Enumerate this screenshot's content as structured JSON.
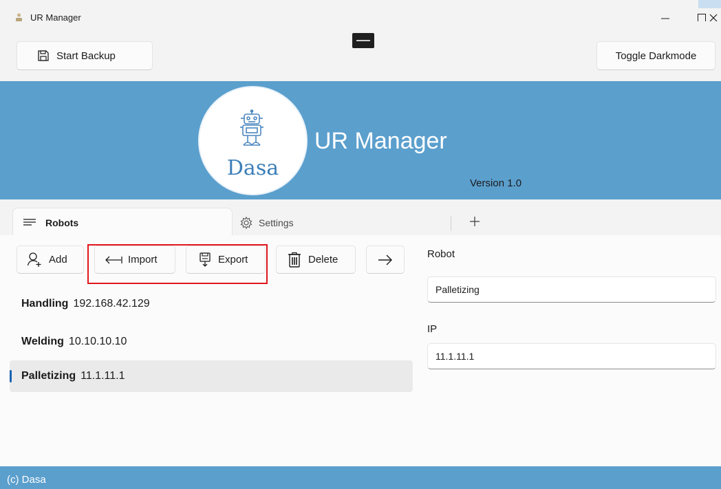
{
  "window": {
    "title": "UR Manager",
    "minimize_icon": "minimize-icon",
    "maximize_icon": "maximize-icon",
    "close_icon": "close-icon"
  },
  "toolbar": {
    "start_backup_label": "Start Backup",
    "start_backup_icon": "floppy-disk-icon",
    "toggle_darkmode_label": "Toggle Darkmode"
  },
  "banner": {
    "logo_text": "Dasa",
    "app_name": "UR Manager",
    "version": "Version 1.0",
    "background_color": "#5b9fcd"
  },
  "tabs": [
    {
      "label": "Robots",
      "icon": "hamburger-icon",
      "selected": true
    },
    {
      "label": "Settings",
      "icon": "gear-icon",
      "selected": false
    }
  ],
  "tab_add_icon": "plus-icon",
  "actions": {
    "add_label": "Add",
    "import_label": "Import",
    "export_label": "Export",
    "delete_label": "Delete",
    "next_icon": "arrow-right-icon"
  },
  "robots": [
    {
      "name": "Handling",
      "ip": "192.168.42.129",
      "selected": false
    },
    {
      "name": "Welding",
      "ip": "10.10.10.10",
      "selected": false
    },
    {
      "name": "Palletizing",
      "ip": "11.1.11.1",
      "selected": true
    }
  ],
  "detail": {
    "robot_label": "Robot",
    "robot_value": "Palletizing",
    "ip_label": "IP",
    "ip_value": "11.1.11.1"
  },
  "footer": {
    "text": "(c) Dasa"
  },
  "colors": {
    "accent": "#1a62b0",
    "highlight": "#e0161c"
  }
}
